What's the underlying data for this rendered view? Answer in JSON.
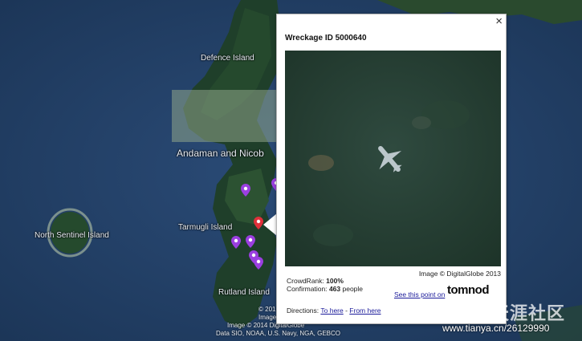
{
  "map": {
    "labels": {
      "defence_island": "Defence Island",
      "andaman": "Andaman and Nicob",
      "north_sentinel": "North Sentinel Island",
      "tarmugli": "Tarmugli Island",
      "rutland": "Rutland Island"
    },
    "attribution": {
      "line1": "© 201",
      "line2": "Image",
      "line3": "Image © 2014 DigitalGlobe",
      "line4": "Data SIO, NOAA, U.S. Navy, NGA, GEBCO"
    },
    "pin_colors": {
      "purple": "#9b3fe0",
      "red": "#e0303a"
    }
  },
  "popup": {
    "close_label": "×",
    "title": "Wreckage ID 5000640",
    "image_credit": "Image © DigitalGlobe 2013",
    "crowdrank_label": "CrowdRank:",
    "crowdrank_value": "100%",
    "confirmation_label": "Confirmation:",
    "confirmation_value": "463",
    "confirmation_suffix": "people",
    "see_point_label": "See this point on",
    "logo_text": "tomnod",
    "directions_label": "Directions:",
    "to_here": "To here",
    "separator": " - ",
    "from_here": "From here"
  },
  "watermark": {
    "text": "天涯社区",
    "url": "www.tianya.cn/26129990"
  }
}
